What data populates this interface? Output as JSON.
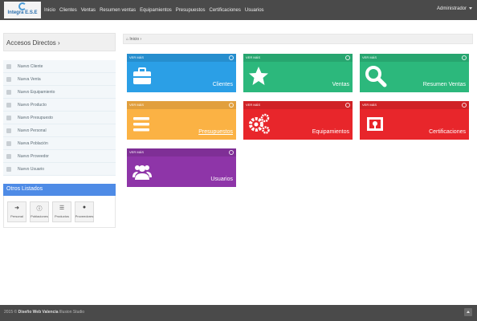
{
  "brand": {
    "logo_text": "Integra E.S.E"
  },
  "nav": {
    "items": [
      "Inicio",
      "Clientes",
      "Ventas",
      "Resumen ventas",
      "Equipamientos",
      "Presupuestos",
      "Certificaciones",
      "Usuarios"
    ],
    "user": "Administrador"
  },
  "sidebar": {
    "accesos_title": "Accesos Directos ›",
    "quick": [
      "Nuevo Cliente",
      "Nueva Venta",
      "Nuevo Equipamiento",
      "Nuevo Producto",
      "Nuevo Presupuesto",
      "Nuevo Personal",
      "Nueva Población",
      "Nuevo Proveedor",
      "Nuevo Usuario"
    ],
    "otros_title": "Otros Listados",
    "otros": [
      {
        "label": "Personal",
        "icon": "arrow-right-icon"
      },
      {
        "label": "Poblaciones",
        "icon": "info-icon"
      },
      {
        "label": "Productos",
        "icon": "list-icon"
      },
      {
        "label": "Proveedores",
        "icon": "globe-icon"
      }
    ]
  },
  "breadcrumb": {
    "text": "Inicio ›"
  },
  "tiles": [
    {
      "label": "Clientes",
      "vermas": "VER MÁS",
      "color": "#2b9fe6",
      "icon": "briefcase-icon"
    },
    {
      "label": "Ventas",
      "vermas": "VER MÁS",
      "color": "#2cb87c",
      "icon": "star-icon"
    },
    {
      "label": "Resumen Ventas",
      "vermas": "VER MÁS",
      "color": "#2cb87c",
      "icon": "search-icon"
    },
    {
      "label": "Presupuestos",
      "vermas": "VER MÁS",
      "color": "#fbb244",
      "icon": "list-icon"
    },
    {
      "label": "Equipamientos",
      "vermas": "VER MÁS",
      "color": "#e8262b",
      "icon": "gears-icon"
    },
    {
      "label": "Certificaciones",
      "vermas": "VER MÁS",
      "color": "#e8262b",
      "icon": "certificate-icon"
    },
    {
      "label": "Usuarios",
      "vermas": "VER MÁS",
      "color": "#8e35a8",
      "icon": "users-icon"
    }
  ],
  "footer": {
    "year": "2015 ©",
    "brand": "Diseño Web Valencia",
    "suffix": "Illusion Studio"
  }
}
